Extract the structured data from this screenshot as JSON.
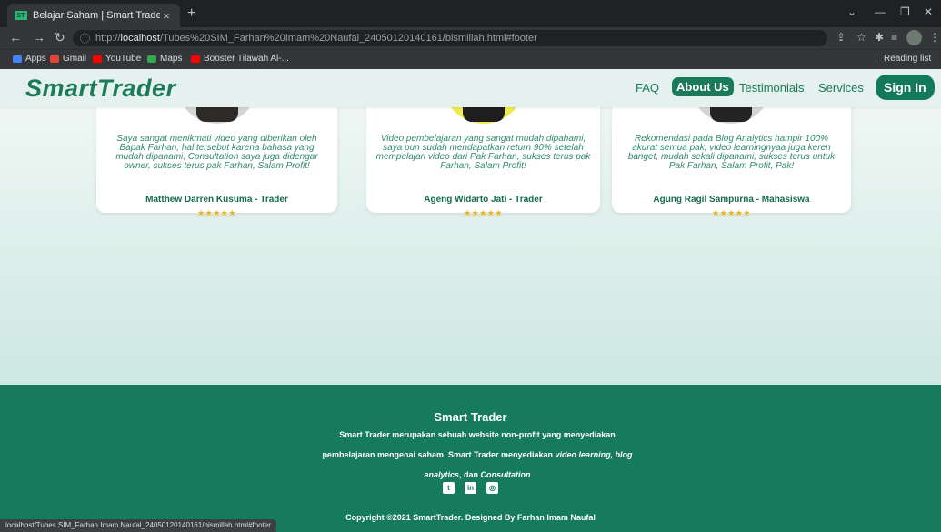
{
  "browser": {
    "tab_favicon": "ST",
    "tab_title": "Belajar Saham | Smart Trader",
    "tab_close": "×",
    "new_tab": "+",
    "url_host": "localhost",
    "url_prefix": "http://",
    "url_path": "/Tubes%20SIM_Farhan%20Imam%20Naufal_24050120140161/bismillah.html#footer",
    "bookmarks": [
      {
        "label": "Apps",
        "color": "#4285f4"
      },
      {
        "label": "Gmail",
        "color": "#ea4335"
      },
      {
        "label": "YouTube",
        "color": "#ff0000"
      },
      {
        "label": "Maps",
        "color": "#34a853"
      },
      {
        "label": "Booster Tilawah Al-...",
        "color": "#ff0000"
      }
    ],
    "reading_list": "Reading list",
    "status_url": "localhost/Tubes SIM_Farhan Imam Naufal_24050120140161/bismillah.html#footer"
  },
  "navbar": {
    "logo": "SmartTrader",
    "links": [
      "FAQ",
      "About Us",
      "Testimonials",
      "Services"
    ],
    "active": "About Us",
    "sign_in": "Sign In"
  },
  "testimonials": [
    {
      "text": "Saya sangat menikmati video yang diberikan oleh Bapak Farhan, hal tersebut karena bahasa yang mudah dipahami, Consultation saya juga didengar owner, sukses terus pak Farhan, Salam Profit!",
      "name": "Matthew Darren Kusuma - Trader",
      "stars": "★★★★★"
    },
    {
      "text": "Video pembelajaran yang sangat mudah dipahami, saya pun sudah mendapatkan return 90% setelah mempelajari video dari Pak Farhan, sukses terus pak Farhan, Salam Profit!",
      "name": "Ageng Widarto Jati - Trader",
      "stars": "★★★★★"
    },
    {
      "text": "Rekomendasi pada Blog Analytics hampir 100% akurat semua pak, video learningnyaa juga keren banget, mudah sekali dipahami, sukses terus untuk Pak Farhan, Salam Profit, Pak!",
      "name": "Agung Ragil Sampurna - Mahasiswa",
      "stars": "★★★★★"
    }
  ],
  "footer": {
    "title": "Smart Trader",
    "desc_1": "Smart Trader merupakan sebuah website non-profit yang menyediakan pembelajaran mengenai saham. Smart Trader menyediakan ",
    "desc_italic_1": "video learning, blog analytics",
    "desc_2": ", dan ",
    "desc_italic_2": "Consultation",
    "socials": [
      {
        "icon": "twitter-icon",
        "glyph": "t"
      },
      {
        "icon": "linkedin-icon",
        "glyph": "in"
      },
      {
        "icon": "instagram-icon",
        "glyph": "◎"
      }
    ],
    "copyright": "Copyright ©2021 SmartTrader. Designed By Farhan Imam Naufal"
  }
}
